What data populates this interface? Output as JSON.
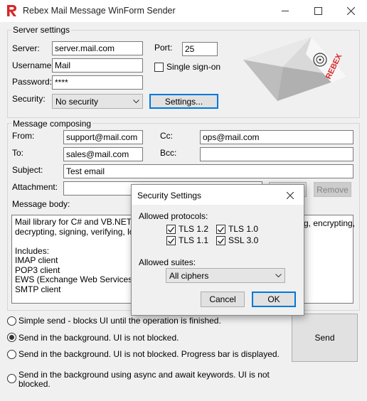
{
  "window": {
    "title": "Rebex Mail Message WinForm Sender"
  },
  "server_settings": {
    "group_label": "Server settings",
    "server_label": "Server:",
    "server_value": "server.mail.com",
    "username_label": "Username:",
    "username_value": "Mail",
    "password_label": "Password:",
    "password_value": "****",
    "security_label": "Security:",
    "security_value": "No security",
    "port_label": "Port:",
    "port_value": "25",
    "sso_label": "Single sign-on",
    "settings_button": "Settings...",
    "brand_text": "REBEX"
  },
  "message": {
    "group_label": "Message composing",
    "from_label": "From:",
    "from_value": "support@mail.com",
    "cc_label": "Cc:",
    "cc_value": "ops@mail.com",
    "to_label": "To:",
    "to_value": "sales@mail.com",
    "bcc_label": "Bcc:",
    "bcc_value": "",
    "subject_label": "Subject:",
    "subject_value": "Test email",
    "attachment_label": "Attachment:",
    "remove_button": "Remove",
    "body_label": "Message body:",
    "body_lines": [
      "Mail library for C# and VB.NET dev",
      "decrypting, signing, verifying, loadin",
      "",
      "Includes:",
      "IMAP client",
      "POP3 client",
      "EWS (Exchange Web Services) cli",
      "SMTP client"
    ],
    "body_right_fragment": "g, encrypting,"
  },
  "send_options": {
    "option1": "Simple send - blocks UI until the operation is finished.",
    "option2": "Send in the background. UI is not blocked.",
    "option3": "Send in the background. UI is not blocked. Progress bar is displayed.",
    "option4_line1": "Send in the background using async and await keywords. UI is not",
    "option4_line2": "blocked.",
    "selected": 2,
    "send_button": "Send"
  },
  "dialog": {
    "title": "Security Settings",
    "protocols_label": "Allowed protocols:",
    "protocols": [
      {
        "label": "TLS 1.2",
        "checked": true
      },
      {
        "label": "TLS 1.0",
        "checked": true
      },
      {
        "label": "TLS 1.1",
        "checked": true
      },
      {
        "label": "SSL 3.0",
        "checked": true
      }
    ],
    "suites_label": "Allowed suites:",
    "suites_value": "All ciphers",
    "cancel_button": "Cancel",
    "ok_button": "OK"
  },
  "colors": {
    "accent": "#0078d7",
    "brand_red": "#d62828"
  }
}
